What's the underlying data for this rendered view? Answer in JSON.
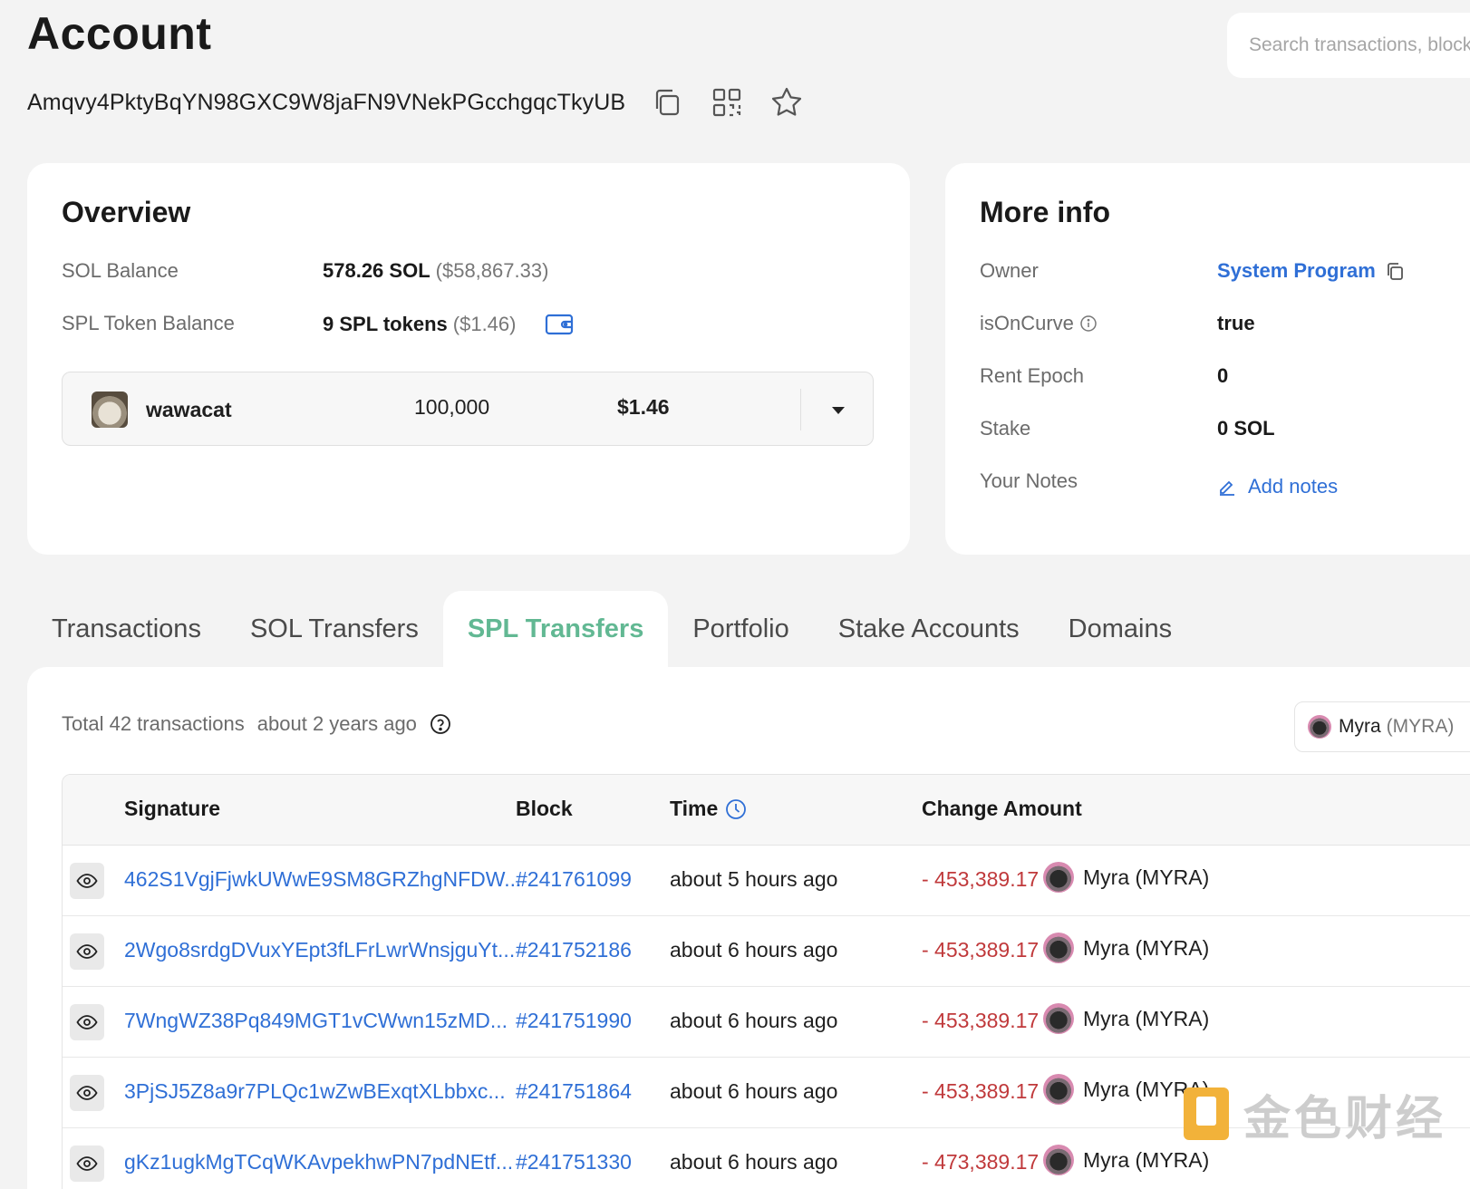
{
  "header": {
    "title": "Account",
    "address": "Amqvy4PktyBqYN98GXC9W8jaFN9VNekPGcchgqcTkyUB",
    "search_placeholder": "Search transactions, blocks"
  },
  "overview": {
    "title": "Overview",
    "sol_balance_label": "SOL Balance",
    "sol_balance_value": "578.26 SOL",
    "sol_balance_usd": "($58,867.33)",
    "spl_balance_label": "SPL Token Balance",
    "spl_balance_value": "9 SPL tokens",
    "spl_balance_usd": "($1.46)",
    "token": {
      "name": "wawacat",
      "amount": "100,000",
      "usd": "$1.46"
    }
  },
  "more_info": {
    "title": "More info",
    "owner_label": "Owner",
    "owner_value": "System Program",
    "isoncurve_label": "isOnCurve",
    "isoncurve_value": "true",
    "rent_epoch_label": "Rent Epoch",
    "rent_epoch_value": "0",
    "stake_label": "Stake",
    "stake_value": "0 SOL",
    "notes_label": "Your Notes",
    "notes_action": "Add notes"
  },
  "tabs": [
    {
      "label": "Transactions",
      "active": false
    },
    {
      "label": "SOL Transfers",
      "active": false
    },
    {
      "label": "SPL Transfers",
      "active": true
    },
    {
      "label": "Portfolio",
      "active": false
    },
    {
      "label": "Stake Accounts",
      "active": false
    },
    {
      "label": "Domains",
      "active": false
    }
  ],
  "transfers": {
    "total_text": "Total 42 transactions",
    "age_text": "about 2 years ago",
    "filter_token_name": "Myra",
    "filter_token_symbol": "(MYRA)",
    "columns": {
      "signature": "Signature",
      "block": "Block",
      "time": "Time",
      "change_amount": "Change Amount"
    },
    "rows": [
      {
        "signature": "462S1VgjFjwkUWwE9SM8GRZhgNFDW...",
        "block": "#241761099",
        "time": "about 5 hours ago",
        "amount": "- 453,389.17",
        "token": "Myra (MYRA)"
      },
      {
        "signature": "2Wgo8srdgDVuxYEpt3fLFrLwrWnsjguYt...",
        "block": "#241752186",
        "time": "about 6 hours ago",
        "amount": "- 453,389.17",
        "token": "Myra (MYRA)"
      },
      {
        "signature": "7WngWZ38Pq849MGT1vCWwn15zMD...",
        "block": "#241751990",
        "time": "about 6 hours ago",
        "amount": "- 453,389.17",
        "token": "Myra (MYRA)"
      },
      {
        "signature": "3PjSJ5Z8a9r7PLQc1wZwBExqtXLbbxc...",
        "block": "#241751864",
        "time": "about 6 hours ago",
        "amount": "- 453,389.17",
        "token": "Myra (MYRA)"
      },
      {
        "signature": "gKz1ugkMgTCqWKAvpekhwPN7pdNEtf...",
        "block": "#241751330",
        "time": "about 6 hours ago",
        "amount": "- 473,389.17",
        "token": "Myra (MYRA)"
      }
    ]
  },
  "watermark": {
    "text": "金色财经"
  },
  "colors": {
    "accent_green": "#62b893",
    "link_blue": "#2f6fd6",
    "negative_red": "#c0393b",
    "background": "#f3f3f3"
  }
}
